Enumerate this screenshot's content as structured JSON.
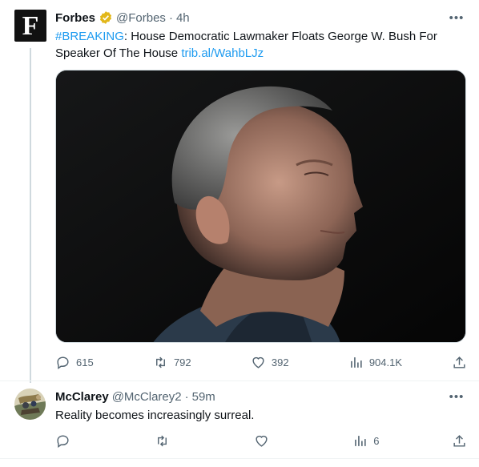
{
  "tweet": {
    "name": "Forbes",
    "handle": "@Forbes",
    "time": "4h",
    "hashtag": "#BREAKING",
    "text": ": House Democratic Lawmaker Floats George W. Bush For Speaker Of The House ",
    "link": "trib.al/WahbLJz",
    "media_alt": "photo-portrait-of-george-w-bush",
    "stats": {
      "replies": "615",
      "retweets": "792",
      "likes": "392",
      "views": "904.1K"
    }
  },
  "reply": {
    "name": "McClarey",
    "handle": "@McClarey2",
    "time": "59m",
    "text": "Reality becomes increasingly surreal.",
    "stats": {
      "replies": "",
      "retweets": "",
      "likes": "",
      "views": "6"
    }
  },
  "colors": {
    "link": "#1d9bf0",
    "verified": "#e2b719",
    "secondary": "#536471"
  }
}
